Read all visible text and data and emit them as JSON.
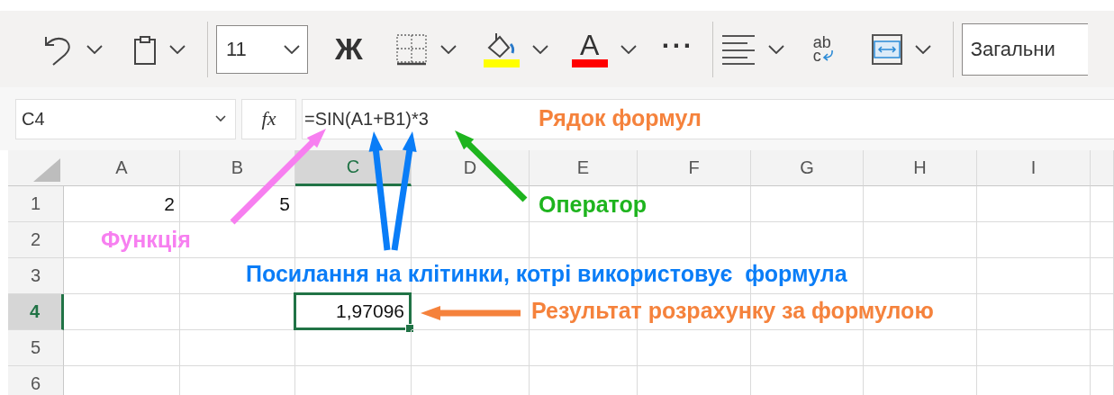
{
  "toolbar": [
    {
      "kind": "undo"
    },
    {
      "kind": "chevron"
    },
    {
      "kind": "clipboard"
    },
    {
      "kind": "chevron"
    },
    {
      "kind": "separator"
    },
    {
      "kind": "font_size",
      "value": "11"
    },
    {
      "kind": "bold",
      "text": "Ж"
    },
    {
      "kind": "borders"
    },
    {
      "kind": "chevron"
    },
    {
      "kind": "fill",
      "color": "#ffff00"
    },
    {
      "kind": "chevron"
    },
    {
      "kind": "font_color",
      "text": "A",
      "color": "#ff0000"
    },
    {
      "kind": "chevron"
    },
    {
      "kind": "more",
      "text": "···"
    },
    {
      "kind": "separator"
    },
    {
      "kind": "align"
    },
    {
      "kind": "chevron"
    },
    {
      "kind": "wrap",
      "text": "ab",
      "text2": "c"
    },
    {
      "kind": "merge"
    },
    {
      "kind": "chevron"
    },
    {
      "kind": "separator"
    },
    {
      "kind": "number_format",
      "value": "Загальни"
    }
  ],
  "formula_bar": {
    "name_box": "C4",
    "fx": "fx",
    "formula": "=SIN(A1+B1)*3"
  },
  "sheet": {
    "columns": [
      {
        "label": "A",
        "selected": false
      },
      {
        "label": "B",
        "selected": false
      },
      {
        "label": "C",
        "selected": true
      },
      {
        "label": "D",
        "selected": false
      },
      {
        "label": "E",
        "selected": false
      },
      {
        "label": "F",
        "selected": false
      },
      {
        "label": "G",
        "selected": false
      },
      {
        "label": "H",
        "selected": false
      },
      {
        "label": "I",
        "selected": false
      }
    ],
    "rows": [
      {
        "label": "1",
        "selected": false,
        "cells": [
          {
            "value": "2",
            "selected": false
          },
          {
            "value": "5",
            "selected": false
          },
          {
            "selected": false
          },
          {
            "selected": false
          },
          {
            "selected": false
          },
          {
            "selected": false
          },
          {
            "selected": false
          },
          {
            "selected": false
          },
          {
            "selected": false
          }
        ]
      },
      {
        "label": "2",
        "selected": false,
        "cells": [
          {
            "selected": false
          },
          {
            "selected": false
          },
          {
            "selected": false
          },
          {
            "selected": false
          },
          {
            "selected": false
          },
          {
            "selected": false
          },
          {
            "selected": false
          },
          {
            "selected": false
          },
          {
            "selected": false
          }
        ]
      },
      {
        "label": "3",
        "selected": false,
        "cells": [
          {
            "selected": false
          },
          {
            "selected": false
          },
          {
            "selected": false
          },
          {
            "selected": false
          },
          {
            "selected": false
          },
          {
            "selected": false
          },
          {
            "selected": false
          },
          {
            "selected": false
          },
          {
            "selected": false
          }
        ]
      },
      {
        "label": "4",
        "selected": true,
        "cells": [
          {
            "selected": false
          },
          {
            "selected": false
          },
          {
            "value": "1,97096",
            "selected": true
          },
          {
            "selected": false
          },
          {
            "selected": false
          },
          {
            "selected": false
          },
          {
            "selected": false
          },
          {
            "selected": false
          },
          {
            "selected": false
          }
        ]
      },
      {
        "label": "5",
        "selected": false,
        "cells": [
          {
            "selected": false
          },
          {
            "selected": false
          },
          {
            "selected": false
          },
          {
            "selected": false
          },
          {
            "selected": false
          },
          {
            "selected": false
          },
          {
            "selected": false
          },
          {
            "selected": false
          },
          {
            "selected": false
          }
        ]
      },
      {
        "label": "6",
        "selected": false,
        "cells": [
          {
            "selected": false
          },
          {
            "selected": false
          },
          {
            "selected": false
          },
          {
            "selected": false
          },
          {
            "selected": false
          },
          {
            "selected": false
          },
          {
            "selected": false
          },
          {
            "selected": false
          },
          {
            "selected": false
          }
        ]
      }
    ]
  },
  "annotations": [
    {
      "text": "Рядок формул",
      "color": "#f5823c"
    },
    {
      "text": "Оператор",
      "color": "#1eb41e"
    },
    {
      "text": "Функція",
      "color": "#f77ff0"
    },
    {
      "text": "Посилання на клітинки, котрі використовує  формула",
      "color": "#0a7df7"
    },
    {
      "text": "Результат розрахунку за формулою",
      "color": "#f5823c"
    }
  ]
}
